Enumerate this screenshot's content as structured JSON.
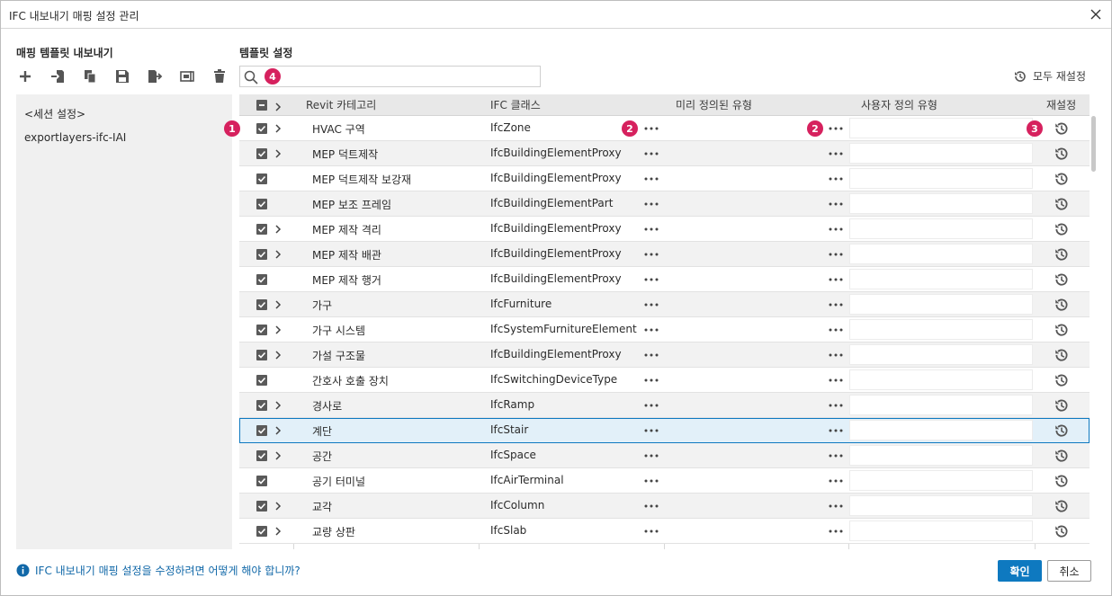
{
  "window": {
    "title": "IFC 내보내기 매핑 설정 관리",
    "close_icon": "close-icon"
  },
  "left": {
    "section_title": "매핑 템플릿 내보내기",
    "toolbar_icons": [
      "add-icon",
      "import-icon",
      "copy-icon",
      "save-icon",
      "export-icon",
      "rename-icon",
      "delete-icon"
    ],
    "items": [
      "<세션 설정>",
      "exportlayers-ifc-IAI"
    ]
  },
  "right": {
    "section_title": "템플릿 설정",
    "search": {
      "value": "",
      "placeholder": ""
    },
    "reset_all_label": "모두 재설정",
    "badges": {
      "row_badge": "1",
      "class_badge": "2",
      "predef_badge": "2",
      "reset_badge": "3",
      "search_badge": "4"
    }
  },
  "table": {
    "columns": [
      "Revit 카테고리",
      "IFC 클래스",
      "미리 정의된 유형",
      "사용자 정의 유형",
      "재설정"
    ],
    "rows": [
      {
        "category": "HVAC 구역",
        "ifc_class": "IfcZone",
        "expand": true
      },
      {
        "category": "MEP 덕트제작",
        "ifc_class": "IfcBuildingElementProxy",
        "expand": true
      },
      {
        "category": "MEP 덕트제작 보강재",
        "ifc_class": "IfcBuildingElementProxy",
        "expand": false
      },
      {
        "category": "MEP 보조 프레임",
        "ifc_class": "IfcBuildingElementPart",
        "expand": false
      },
      {
        "category": "MEP 제작 격리",
        "ifc_class": "IfcBuildingElementProxy",
        "expand": true
      },
      {
        "category": "MEP 제작 배관",
        "ifc_class": "IfcBuildingElementProxy",
        "expand": true
      },
      {
        "category": "MEP 제작 행거",
        "ifc_class": "IfcBuildingElementProxy",
        "expand": false
      },
      {
        "category": "가구",
        "ifc_class": "IfcFurniture",
        "expand": true
      },
      {
        "category": "가구 시스템",
        "ifc_class": "IfcSystemFurnitureElement",
        "expand": true
      },
      {
        "category": "가설 구조물",
        "ifc_class": "IfcBuildingElementProxy",
        "expand": true
      },
      {
        "category": "간호사 호출 장치",
        "ifc_class": "IfcSwitchingDeviceType",
        "expand": false
      },
      {
        "category": "경사로",
        "ifc_class": "IfcRamp",
        "expand": true
      },
      {
        "category": "계단",
        "ifc_class": "IfcStair",
        "expand": true,
        "selected": true
      },
      {
        "category": "공간",
        "ifc_class": "IfcSpace",
        "expand": true
      },
      {
        "category": "공기 터미널",
        "ifc_class": "IfcAirTerminal",
        "expand": false
      },
      {
        "category": "교각",
        "ifc_class": "IfcColumn",
        "expand": true
      },
      {
        "category": "교량 상판",
        "ifc_class": "IfcSlab",
        "expand": true
      }
    ]
  },
  "footer": {
    "help_text": "IFC 내보내기 매핑 설정을 수정하려면 어떻게 해야 합니까?",
    "ok_label": "확인",
    "cancel_label": "취소"
  },
  "colors": {
    "accent": "#0e79c0",
    "badge": "#d6215e",
    "panel_bg": "#f0f0f0",
    "selected_row": "#e2f0f9"
  }
}
